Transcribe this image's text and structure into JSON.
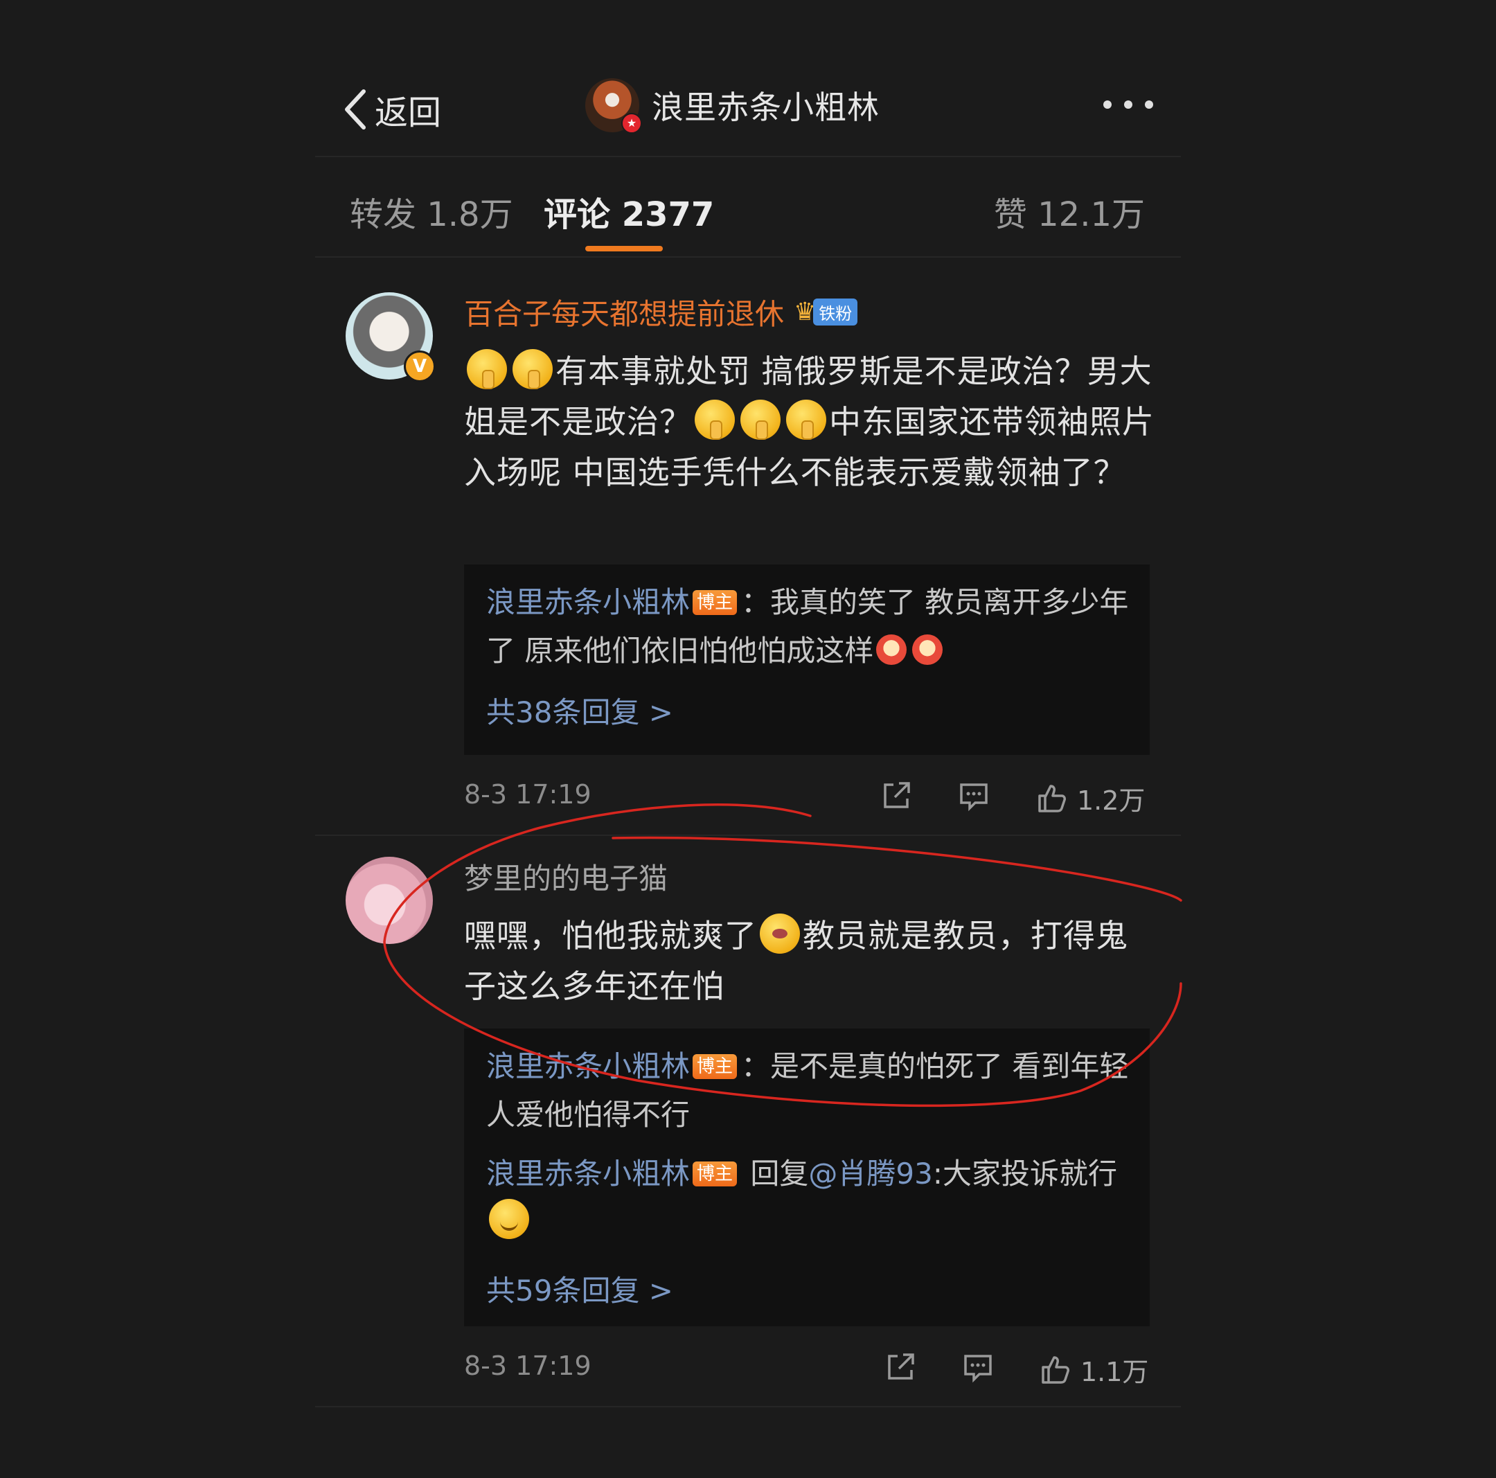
{
  "header": {
    "back_label": "返回",
    "title": "浪里赤条小粗林"
  },
  "tabs": {
    "repost": "转发 1.8万",
    "comments": "评论 2377",
    "likes": "赞 12.1万",
    "active": "comments"
  },
  "comments": [
    {
      "username": "百合子每天都想提前退休",
      "fan_badge": "铁粉",
      "text_parts": [
        "有本事就处罚 搞俄罗斯是不是政治？男大姐是不是政治？",
        "中东国家还带领袖照片入场呢 中国选手凭什么不能表示爱戴领袖了？"
      ],
      "replies": [
        {
          "name": "浪里赤条小粗林",
          "badge": "博主",
          "text": "：我真的笑了 教员离开多少年了 原来他们依旧怕他怕成这样"
        }
      ],
      "more_replies": "共38条回复 >",
      "time": "8-3 17:19",
      "likes": "1.2万"
    },
    {
      "username": "梦里的的电子猫",
      "text_parts": [
        "嘿嘿，怕他我就爽了",
        "教员就是教员，打得鬼子这么多年还在怕"
      ],
      "replies": [
        {
          "name": "浪里赤条小粗林",
          "badge": "博主",
          "text": "：是不是真的怕死了 看到年轻人爱他怕得不行"
        },
        {
          "name": "浪里赤条小粗林",
          "badge": "博主",
          "reply_word": "回复",
          "at": "@肖腾93",
          "text": ":大家投诉就行"
        }
      ],
      "more_replies": "共59条回复 >",
      "time": "8-3 17:19",
      "likes": "1.1万"
    }
  ],
  "colors": {
    "background": "#1b1b1b",
    "accent": "#f07a1f",
    "username_orange": "#e8742f",
    "link_blue": "#7b98c4",
    "annotation_red": "#d8261f"
  }
}
